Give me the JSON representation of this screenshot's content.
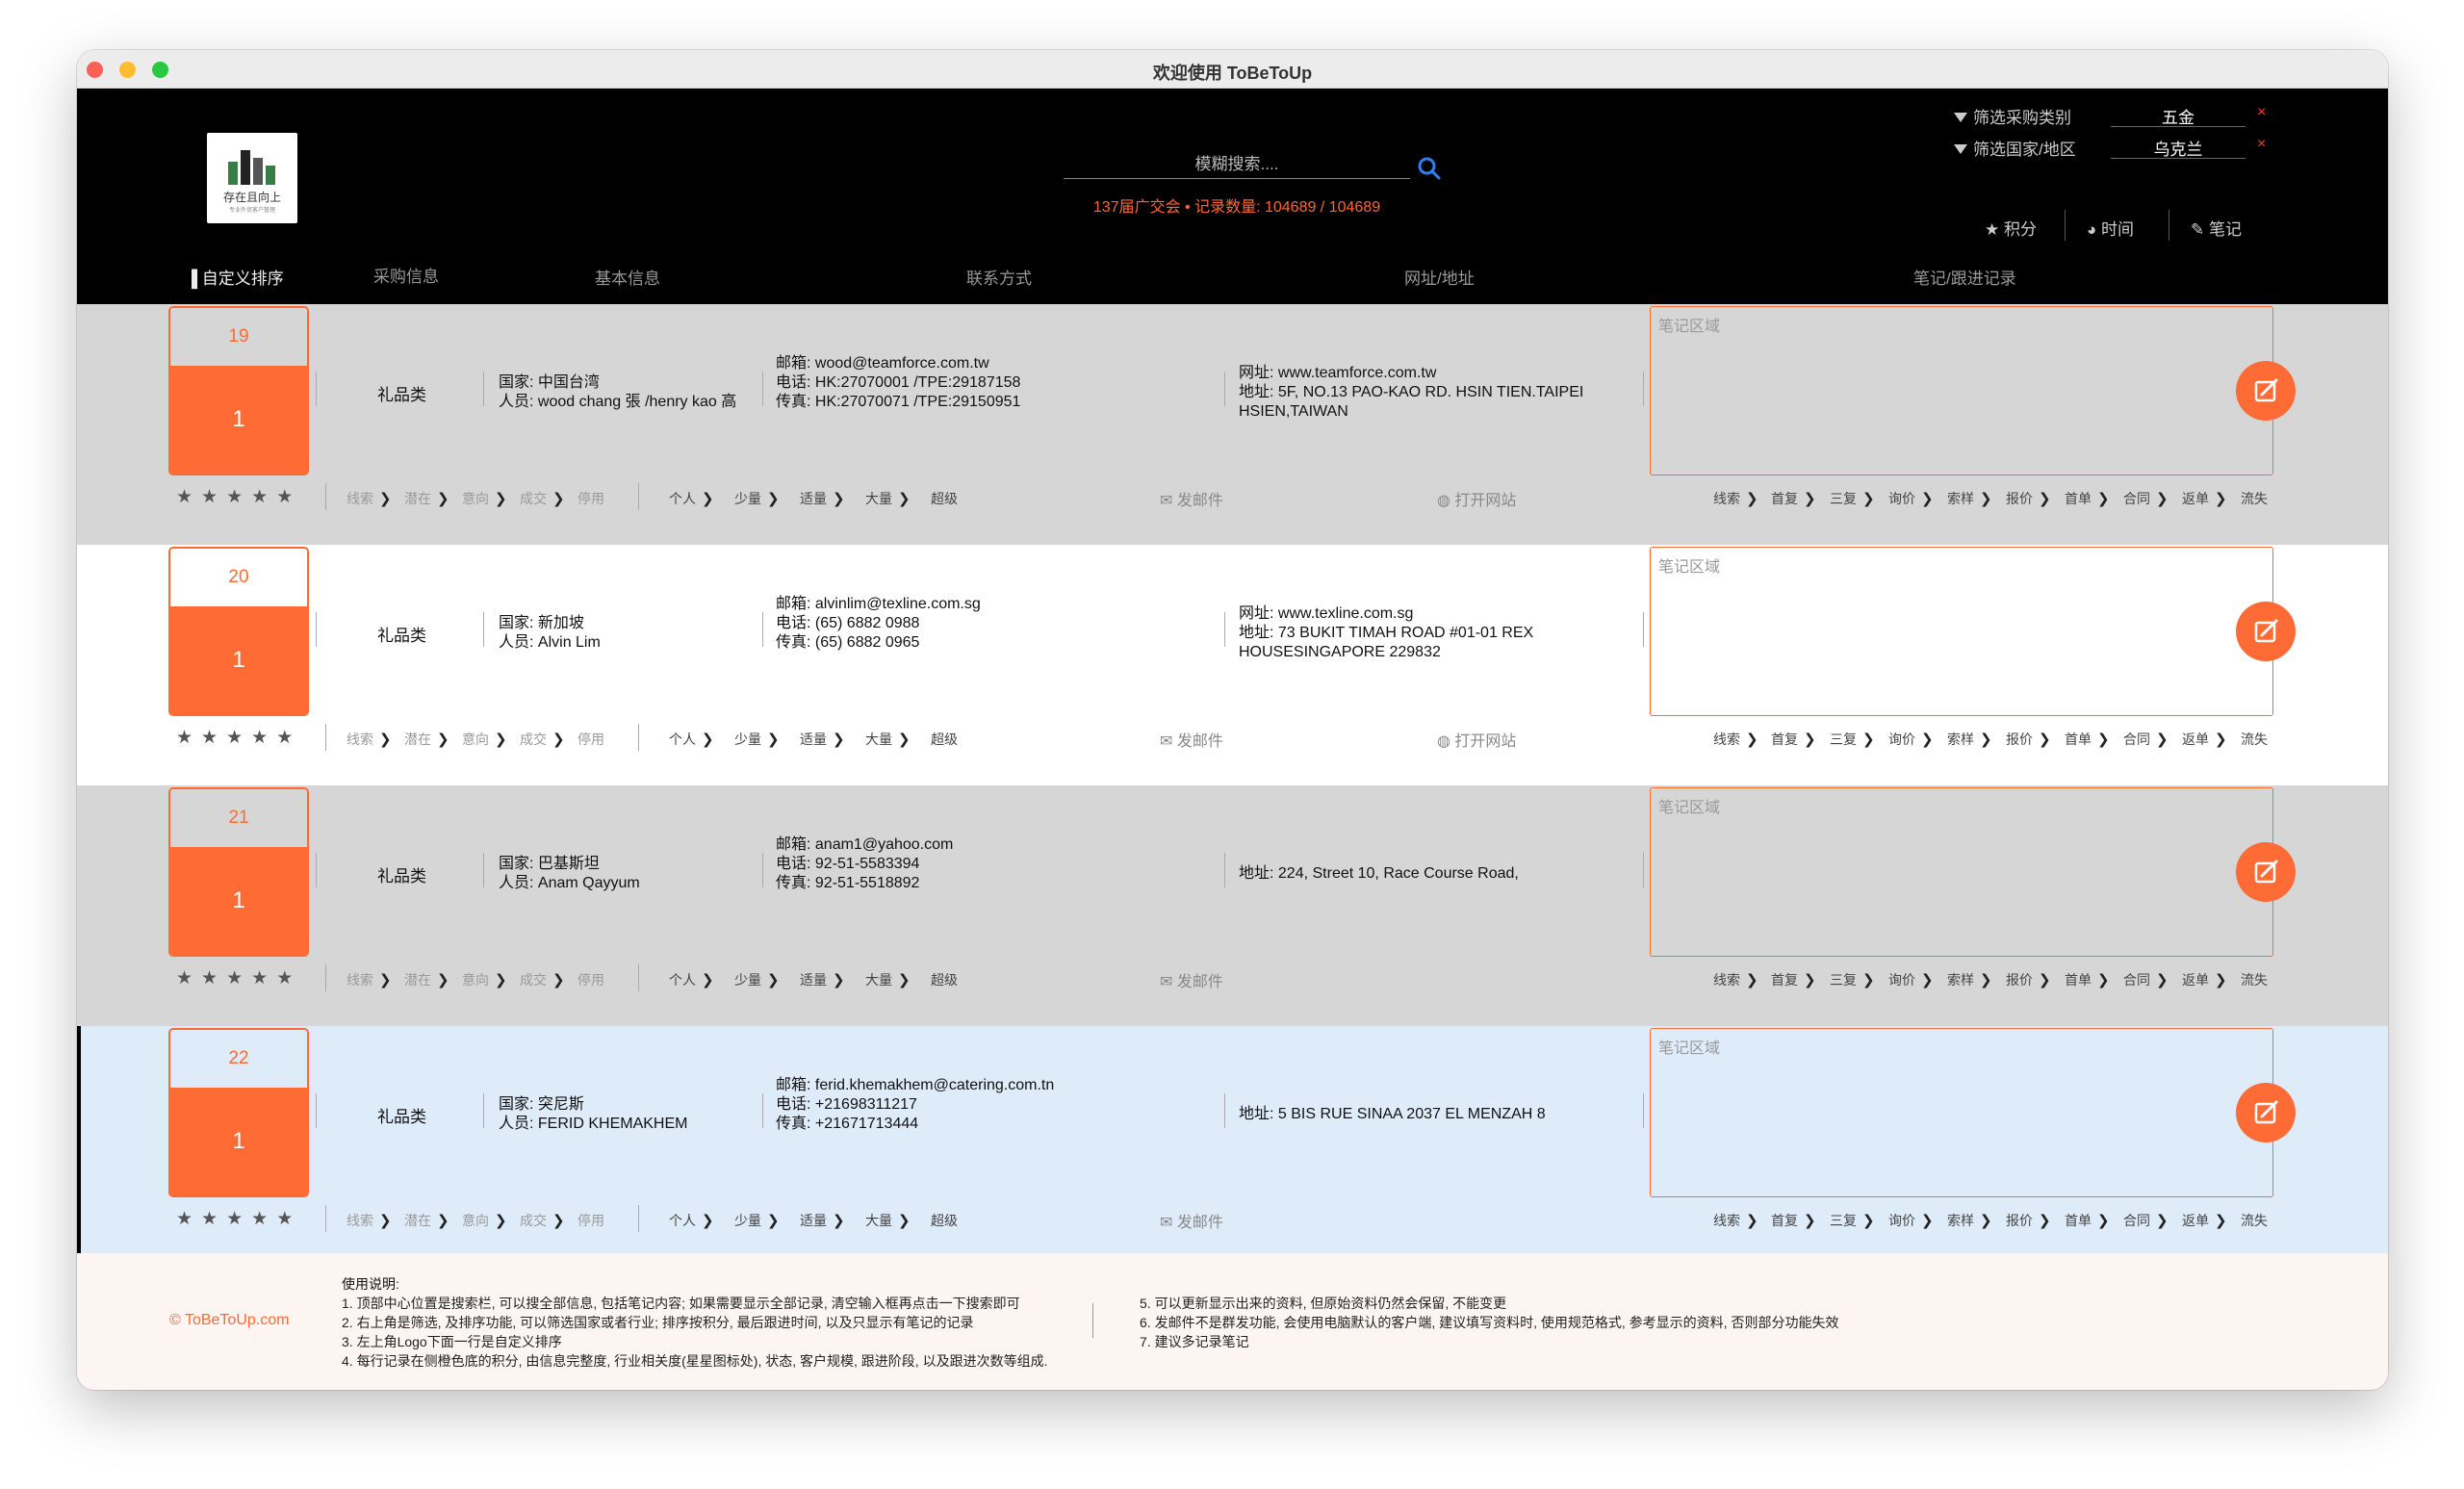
{
  "window": {
    "title": "欢迎使用 ToBeToUp"
  },
  "logo": {
    "caption": "存在且向上",
    "subcaption": "专业外贸客户管理"
  },
  "search": {
    "placeholder": "模糊搜索....",
    "status": "137届广交会 • 记录数量: 104689 / 104689"
  },
  "filters": [
    {
      "label": "筛选采购类别",
      "value": "五金",
      "clear": "×"
    },
    {
      "label": "筛选国家/地区",
      "value": "乌克兰",
      "clear": "×"
    }
  ],
  "sort_buttons": [
    {
      "label": "积分",
      "icon": "star-icon"
    },
    {
      "label": "时间",
      "icon": "clock-icon"
    },
    {
      "label": "笔记",
      "icon": "note-icon"
    }
  ],
  "columns": [
    "自定义排序",
    "采购信息",
    "基本信息",
    "联系方式",
    "网址/地址",
    "笔记/跟进记录"
  ],
  "colors": {
    "accent": "#ff6b35",
    "header_bg": "#000000",
    "status_text": "#ff6633",
    "row_gray": "#d6d6d6",
    "row_blue": "#deebf9"
  },
  "labels": {
    "country": "国家: ",
    "person": "人员: ",
    "email": "邮箱: ",
    "phone": "电话: ",
    "fax": "传真: ",
    "website": "网址: ",
    "address": "地址: ",
    "notes_placeholder": "笔记区域",
    "send_email": "发邮件",
    "open_site": "打开网站"
  },
  "stage_chips": [
    "线索",
    "潜在",
    "意向",
    "成交",
    "停用"
  ],
  "size_chips": [
    "个人",
    "少量",
    "适量",
    "大量",
    "超级"
  ],
  "followup_chips": [
    "线索",
    "首复",
    "三复",
    "询价",
    "索样",
    "报价",
    "首单",
    "合同",
    "返单",
    "流失"
  ],
  "records": [
    {
      "index": "19",
      "score": "1",
      "category": "礼品类",
      "country": "中国台湾",
      "person": "wood chang 張 /henry kao 高",
      "email": "wood@teamforce.com.tw",
      "phone": "HK:27070001 /TPE:29187158",
      "fax": "HK:27070071 /TPE:29150951",
      "website": "www.teamforce.com.tw",
      "address": "5F, NO.13 PAO-KAO RD. HSIN TIEN.TAIPEI HSIEN,TAIWAN",
      "has_site": true
    },
    {
      "index": "20",
      "score": "1",
      "category": "礼品类",
      "country": "新加坡",
      "person": "Alvin Lim",
      "email": "alvinlim@texline.com.sg",
      "phone": "(65) 6882 0988",
      "fax": "(65) 6882 0965",
      "website": "www.texline.com.sg",
      "address": "73 BUKIT TIMAH ROAD #01-01 REX HOUSESINGAPORE 229832",
      "has_site": true
    },
    {
      "index": "21",
      "score": "1",
      "category": "礼品类",
      "country": "巴基斯坦",
      "person": "Anam Qayyum",
      "email": "anam1@yahoo.com",
      "phone": "92-51-5583394",
      "fax": "92-51-5518892",
      "website": "",
      "address": "224, Street 10, Race Course Road,",
      "has_site": false
    },
    {
      "index": "22",
      "score": "1",
      "category": "礼品类",
      "country": "突尼斯",
      "person": "FERID KHEMAKHEM",
      "email": "ferid.khemakhem@catering.com.tn",
      "phone": "+21698311217",
      "fax": "+21671713444",
      "website": "",
      "address": "5 BIS RUE SINAA 2037 EL MENZAH 8",
      "has_site": false
    }
  ],
  "footer": {
    "copyright": "© ToBeToUp.com",
    "instructions_title": "使用说明:",
    "instructions_left": [
      "1. 顶部中心位置是搜索栏, 可以搜全部信息, 包括笔记内容; 如果需要显示全部记录, 清空输入框再点击一下搜索即可",
      "2. 右上角是筛选, 及排序功能, 可以筛选国家或者行业; 排序按积分, 最后跟进时间, 以及只显示有笔记的记录",
      "3. 左上角Logo下面一行是自定义排序",
      "4. 每行记录在侧橙色底的积分, 由信息完整度, 行业相关度(星星图标处), 状态, 客户规模, 跟进阶段, 以及跟进次数等组成."
    ],
    "instructions_right": [
      "5. 可以更新显示出来的资料, 但原始资料仍然会保留, 不能变更",
      "6. 发邮件不是群发功能, 会使用电脑默认的客户端, 建议填写资料时, 使用规范格式, 参考显示的资料, 否则部分功能失效",
      "7. 建议多记录笔记"
    ]
  }
}
